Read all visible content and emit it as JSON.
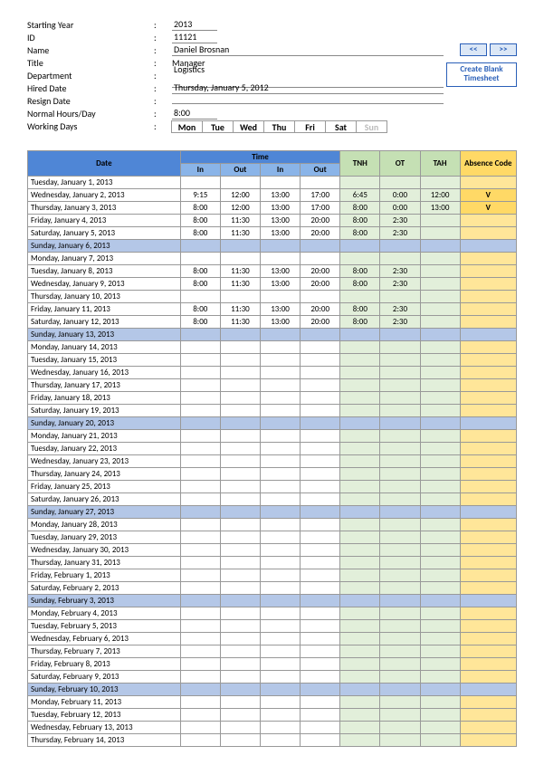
{
  "info": {
    "starting_year_label": "Starting Year",
    "starting_year": "2013",
    "id_label": "ID",
    "id": "11121",
    "name_label": "Name",
    "name": "Daniel Brosnan",
    "title_label": "Title",
    "title": "Manager",
    "department_label": "Department",
    "department": "Logistics",
    "hired_label": "Hired Date",
    "hired": "Thursday, January 5, 2012",
    "resign_label": "Resign Date",
    "resign": "",
    "hours_label": "Normal Hours/Day",
    "hours": "8:00",
    "working_label": "Working Days",
    "prev_btn": "<<",
    "next_btn": ">>",
    "create_l1": "Create Blank",
    "create_l2": "Timesheet",
    "days": [
      "Mon",
      "Tue",
      "Wed",
      "Thu",
      "Fri",
      "Sat",
      "Sun"
    ]
  },
  "headers": {
    "date": "Date",
    "time": "Time",
    "in": "In",
    "out": "Out",
    "tnh": "TNH",
    "ot": "OT",
    "tah": "TAH",
    "abs": "Absence Code"
  },
  "rows": [
    {
      "date": "Tuesday, January 1, 2013"
    },
    {
      "date": "Wednesday, January 2, 2013",
      "in1": "9:15",
      "out1": "12:00",
      "in2": "13:00",
      "out2": "17:00",
      "tnh": "6:45",
      "ot": "0:00",
      "tah": "12:00",
      "abs": "V"
    },
    {
      "date": "Thursday, January 3, 2013",
      "in1": "8:00",
      "out1": "12:00",
      "in2": "13:00",
      "out2": "17:00",
      "tnh": "8:00",
      "ot": "0:00",
      "tah": "13:00",
      "abs": "V"
    },
    {
      "date": "Friday, January 4, 2013",
      "in1": "8:00",
      "out1": "11:30",
      "in2": "13:00",
      "out2": "20:00",
      "tnh": "8:00",
      "ot": "2:30"
    },
    {
      "date": "Saturday, January 5, 2013",
      "in1": "8:00",
      "out1": "11:30",
      "in2": "13:00",
      "out2": "20:00",
      "tnh": "8:00",
      "ot": "2:30"
    },
    {
      "date": "Sunday, January 6, 2013",
      "sunday": true
    },
    {
      "date": "Monday, January 7, 2013"
    },
    {
      "date": "Tuesday, January 8, 2013",
      "in1": "8:00",
      "out1": "11:30",
      "in2": "13:00",
      "out2": "20:00",
      "tnh": "8:00",
      "ot": "2:30"
    },
    {
      "date": "Wednesday, January 9, 2013",
      "in1": "8:00",
      "out1": "11:30",
      "in2": "13:00",
      "out2": "20:00",
      "tnh": "8:00",
      "ot": "2:30"
    },
    {
      "date": "Thursday, January 10, 2013"
    },
    {
      "date": "Friday, January 11, 2013",
      "in1": "8:00",
      "out1": "11:30",
      "in2": "13:00",
      "out2": "20:00",
      "tnh": "8:00",
      "ot": "2:30"
    },
    {
      "date": "Saturday, January 12, 2013",
      "in1": "8:00",
      "out1": "11:30",
      "in2": "13:00",
      "out2": "20:00",
      "tnh": "8:00",
      "ot": "2:30"
    },
    {
      "date": "Sunday, January 13, 2013",
      "sunday": true
    },
    {
      "date": "Monday, January 14, 2013"
    },
    {
      "date": "Tuesday, January 15, 2013"
    },
    {
      "date": "Wednesday, January 16, 2013"
    },
    {
      "date": "Thursday, January 17, 2013"
    },
    {
      "date": "Friday, January 18, 2013"
    },
    {
      "date": "Saturday, January 19, 2013"
    },
    {
      "date": "Sunday, January 20, 2013",
      "sunday": true
    },
    {
      "date": "Monday, January 21, 2013"
    },
    {
      "date": "Tuesday, January 22, 2013"
    },
    {
      "date": "Wednesday, January 23, 2013"
    },
    {
      "date": "Thursday, January 24, 2013"
    },
    {
      "date": "Friday, January 25, 2013"
    },
    {
      "date": "Saturday, January 26, 2013"
    },
    {
      "date": "Sunday, January 27, 2013",
      "sunday": true
    },
    {
      "date": "Monday, January 28, 2013"
    },
    {
      "date": "Tuesday, January 29, 2013"
    },
    {
      "date": "Wednesday, January 30, 2013"
    },
    {
      "date": "Thursday, January 31, 2013"
    },
    {
      "date": "Friday, February 1, 2013"
    },
    {
      "date": "Saturday, February 2, 2013"
    },
    {
      "date": "Sunday, February 3, 2013",
      "sunday": true
    },
    {
      "date": "Monday, February 4, 2013"
    },
    {
      "date": "Tuesday, February 5, 2013"
    },
    {
      "date": "Wednesday, February 6, 2013"
    },
    {
      "date": "Thursday, February 7, 2013"
    },
    {
      "date": "Friday, February 8, 2013"
    },
    {
      "date": "Saturday, February 9, 2013"
    },
    {
      "date": "Sunday, February 10, 2013",
      "sunday": true
    },
    {
      "date": "Monday, February 11, 2013"
    },
    {
      "date": "Tuesday, February 12, 2013"
    },
    {
      "date": "Wednesday, February 13, 2013"
    },
    {
      "date": "Thursday, February 14, 2013"
    }
  ]
}
